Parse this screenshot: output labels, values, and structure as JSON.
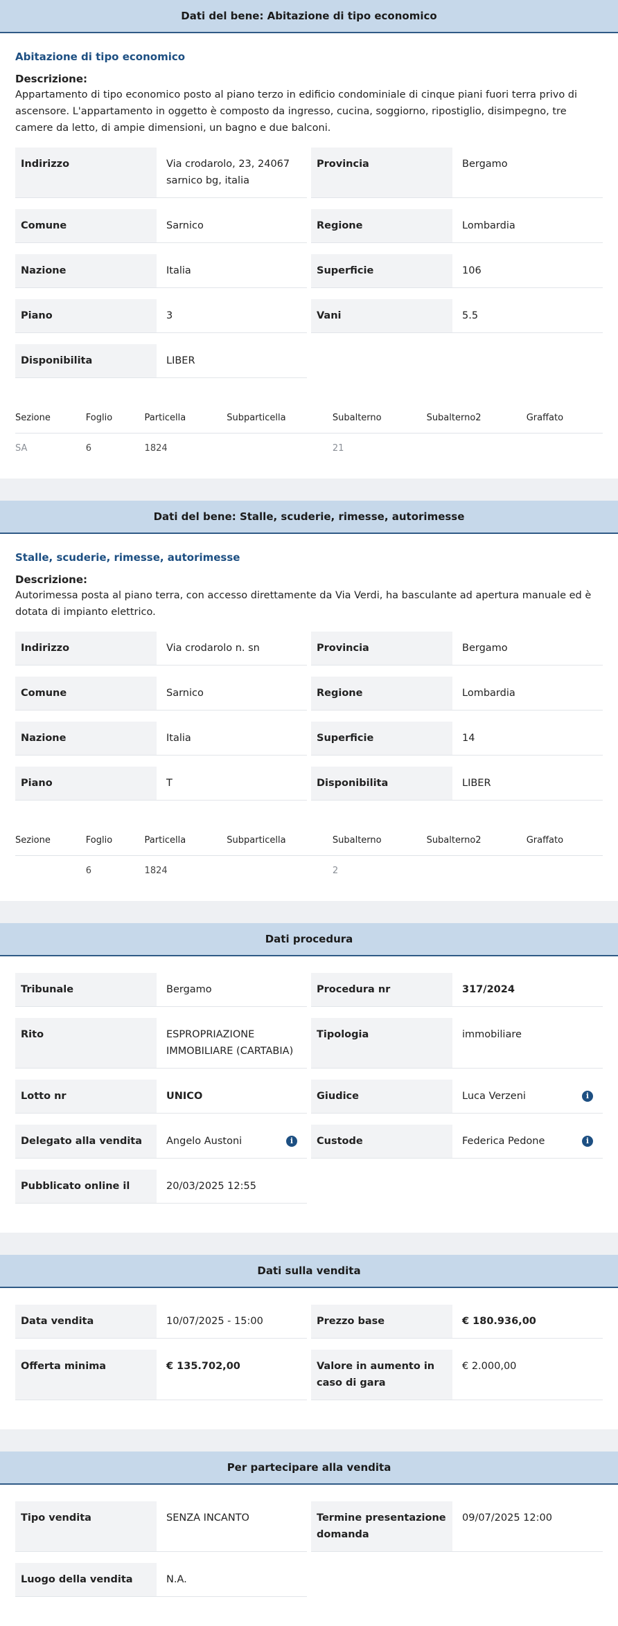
{
  "beni": [
    {
      "header": "Dati del bene: Abitazione di tipo economico",
      "title": "Abitazione di tipo economico",
      "desc_label": "Descrizione:",
      "desc": "Appartamento di tipo economico posto al piano terzo in edificio condominiale di cinque piani fuori terra privo di ascensore. L'appartamento in oggetto è composto da ingresso, cucina, soggiorno, ripostiglio, disimpegno, tre camere da letto, di ampie dimensioni, un bagno e due balconi.",
      "fields": [
        {
          "label": "Indirizzo",
          "value": "Via crodarolo, 23, 24067 sarnico bg, italia"
        },
        {
          "label": "Provincia",
          "value": "Bergamo"
        },
        {
          "label": "Comune",
          "value": "Sarnico"
        },
        {
          "label": "Regione",
          "value": "Lombardia"
        },
        {
          "label": "Nazione",
          "value": "Italia"
        },
        {
          "label": "Superficie",
          "value": "106"
        },
        {
          "label": "Piano",
          "value": "3"
        },
        {
          "label": "Vani",
          "value": "5.5"
        },
        {
          "label": "Disponibilita",
          "value": "LIBER"
        }
      ],
      "catasto": {
        "headers": [
          "Sezione",
          "Foglio",
          "Particella",
          "Subparticella",
          "Subalterno",
          "Subalterno2",
          "Graffato"
        ],
        "row": [
          "SA",
          "6",
          "1824",
          "",
          "21",
          "",
          ""
        ]
      }
    },
    {
      "header": "Dati del bene: Stalle, scuderie, rimesse, autorimesse",
      "title": "Stalle, scuderie, rimesse, autorimesse",
      "desc_label": "Descrizione:",
      "desc": "Autorimessa posta al piano terra, con accesso direttamente da Via Verdi, ha basculante ad apertura manuale ed è dotata di impianto elettrico.",
      "fields": [
        {
          "label": "Indirizzo",
          "value": "Via crodarolo n. sn"
        },
        {
          "label": "Provincia",
          "value": "Bergamo"
        },
        {
          "label": "Comune",
          "value": "Sarnico"
        },
        {
          "label": "Regione",
          "value": "Lombardia"
        },
        {
          "label": "Nazione",
          "value": "Italia"
        },
        {
          "label": "Superficie",
          "value": "14"
        },
        {
          "label": "Piano",
          "value": "T"
        },
        {
          "label": "Disponibilita",
          "value": "LIBER"
        }
      ],
      "catasto": {
        "headers": [
          "Sezione",
          "Foglio",
          "Particella",
          "Subparticella",
          "Subalterno",
          "Subalterno2",
          "Graffato"
        ],
        "row": [
          "",
          "6",
          "1824",
          "",
          "2",
          "",
          ""
        ]
      }
    }
  ],
  "procedura": {
    "header": "Dati procedura",
    "fields": [
      {
        "label": "Tribunale",
        "value": "Bergamo"
      },
      {
        "label": "Procedura nr",
        "value": "317/2024",
        "strong": true
      },
      {
        "label": "Rito",
        "value": "ESPROPRIAZIONE IMMOBILIARE (CARTABIA)"
      },
      {
        "label": "Tipologia",
        "value": "immobiliare"
      },
      {
        "label": "Lotto nr",
        "value": "UNICO",
        "strong": true
      },
      {
        "label": "Giudice",
        "value": "Luca Verzeni",
        "info": true
      },
      {
        "label": "Delegato alla vendita",
        "value": "Angelo Austoni",
        "info": true
      },
      {
        "label": "Custode",
        "value": "Federica Pedone",
        "info": true
      },
      {
        "label": "Pubblicato online il",
        "value": "20/03/2025 12:55"
      }
    ]
  },
  "vendita": {
    "header": "Dati sulla vendita",
    "fields": [
      {
        "label": "Data vendita",
        "value": "10/07/2025 - 15:00"
      },
      {
        "label": "Prezzo base",
        "value": "€ 180.936,00",
        "strong": true
      },
      {
        "label": "Offerta minima",
        "value": "€ 135.702,00",
        "strong": true
      },
      {
        "label": "Valore in aumento in caso di gara",
        "value": "€ 2.000,00"
      }
    ]
  },
  "partecipare": {
    "header": "Per partecipare alla vendita",
    "fields": [
      {
        "label": "Tipo vendita",
        "value": "SENZA INCANTO"
      },
      {
        "label": "Termine presentazione domanda",
        "value": "09/07/2025 12:00"
      },
      {
        "label": "Luogo della vendita",
        "value": "N.A."
      }
    ]
  },
  "icons": {
    "info": "info-circle-icon"
  },
  "colors": {
    "header_bg": "#c6d8ea",
    "header_border": "#2f5a86",
    "title": "#1d4f82",
    "label_bg": "#f2f3f5"
  }
}
